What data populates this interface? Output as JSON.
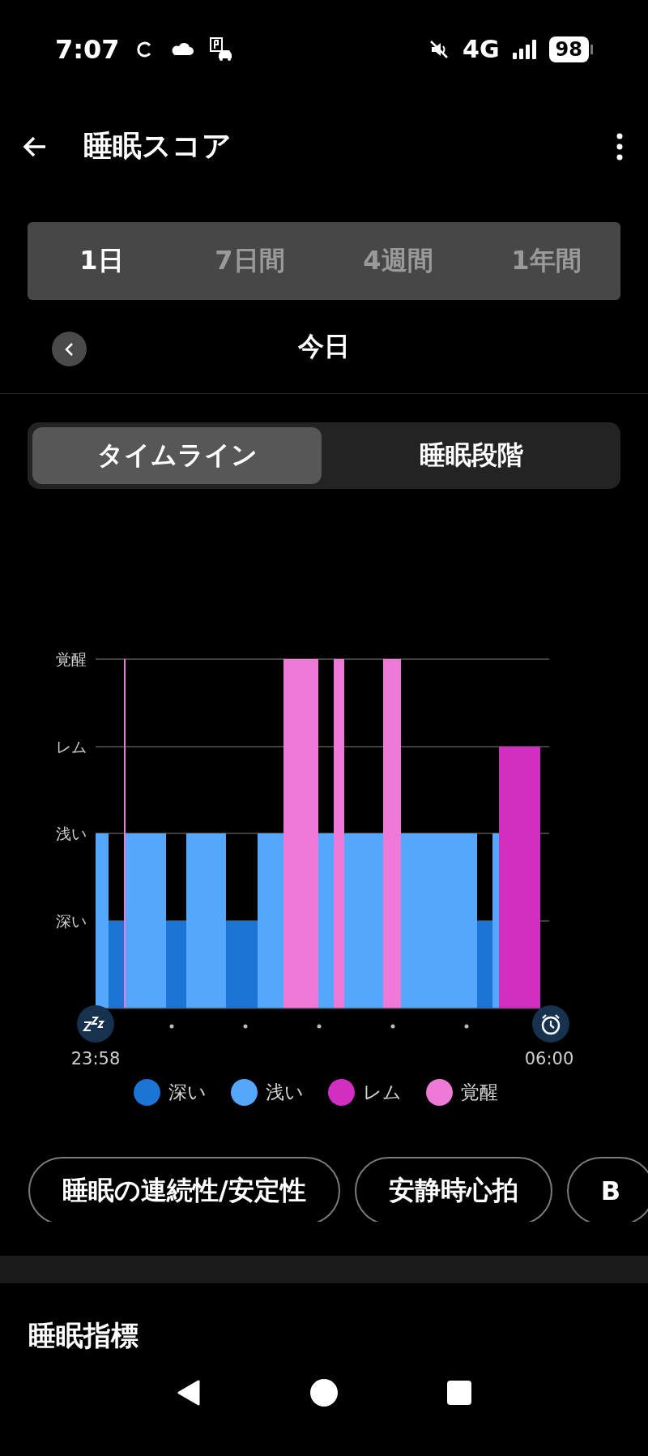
{
  "status_bar": {
    "time": "7:07",
    "network": "4G",
    "battery": "98"
  },
  "header": {
    "title": "睡眠スコア"
  },
  "period_tabs": [
    {
      "label": "1日",
      "selected": true
    },
    {
      "label": "7日間",
      "selected": false
    },
    {
      "label": "4週間",
      "selected": false
    },
    {
      "label": "1年間",
      "selected": false
    }
  ],
  "date_nav": {
    "label": "今日"
  },
  "view_toggle": [
    {
      "label": "タイムライン",
      "selected": true
    },
    {
      "label": "睡眠段階",
      "selected": false
    }
  ],
  "chart": {
    "stage_labels": [
      "覚醒",
      "レム",
      "浅い",
      "深い"
    ],
    "start_time": "23:58",
    "end_time": "06:00"
  },
  "legend": [
    {
      "label": "深い",
      "color": "#1c74d4"
    },
    {
      "label": "浅い",
      "color": "#55a7fd"
    },
    {
      "label": "レム",
      "color": "#d22fc2"
    },
    {
      "label": "覚醒",
      "color": "#ee79d6"
    }
  ],
  "chips": [
    "睡眠の連続性/安定性",
    "安静時心拍",
    "B"
  ],
  "section": {
    "title": "睡眠指標"
  }
}
